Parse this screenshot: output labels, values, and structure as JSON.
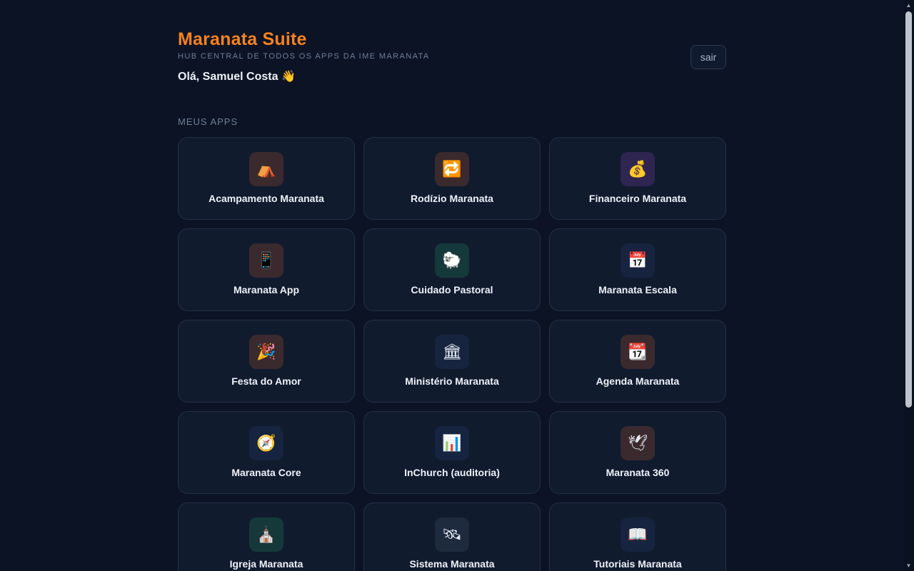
{
  "header": {
    "title": "Maranata Suite",
    "subtitle": "HUB CENTRAL DE TODOS OS APPS DA IME MARANATA",
    "greeting": "Olá, Samuel Costa 👋",
    "logout_label": "sair"
  },
  "section": {
    "label": "MEUS APPS"
  },
  "apps": [
    {
      "label": "Acampamento Maranata",
      "icon": "⛺",
      "icon_name": "camping-icon",
      "icon_bg": "#3a2a2e"
    },
    {
      "label": "Rodízio Maranata",
      "icon": "🔁",
      "icon_name": "repeat-icon",
      "icon_bg": "#3a2a2e"
    },
    {
      "label": "Financeiro Maranata",
      "icon": "💰",
      "icon_name": "money-bag-icon",
      "icon_bg": "#2e2550"
    },
    {
      "label": "Maranata App",
      "icon": "📱",
      "icon_name": "mobile-phone-icon",
      "icon_bg": "#3a2a2e"
    },
    {
      "label": "Cuidado Pastoral",
      "icon": "🐑",
      "icon_name": "sheep-icon",
      "icon_bg": "#15393b"
    },
    {
      "label": "Maranata Escala",
      "icon": "📅",
      "icon_name": "calendar-icon",
      "icon_bg": "#172440"
    },
    {
      "label": "Festa do Amor",
      "icon": "🎉",
      "icon_name": "party-popper-icon",
      "icon_bg": "#3a2a2e"
    },
    {
      "label": "Ministério Maranata",
      "icon": "🏛",
      "icon_name": "classical-building-icon",
      "icon_bg": "#172440"
    },
    {
      "label": "Agenda Maranata",
      "icon": "📆",
      "icon_name": "tear-off-calendar-icon",
      "icon_bg": "#3a2a2e"
    },
    {
      "label": "Maranata Core",
      "icon": "🧭",
      "icon_name": "compass-icon",
      "icon_bg": "#172440"
    },
    {
      "label": "InChurch (auditoria)",
      "icon": "📊",
      "icon_name": "bar-chart-icon",
      "icon_bg": "#172440"
    },
    {
      "label": "Maranata 360",
      "icon": "🕊",
      "icon_name": "dove-icon",
      "icon_bg": "#3a2a2e"
    },
    {
      "label": "Igreja Maranata",
      "icon": "⛪",
      "icon_name": "church-icon",
      "icon_bg": "#15393b"
    },
    {
      "label": "Sistema Maranata",
      "icon": "🛰",
      "icon_name": "satellite-icon",
      "icon_bg": "#1e2a3e"
    },
    {
      "label": "Tutoriais Maranata",
      "icon": "📖",
      "icon_name": "open-book-icon",
      "icon_bg": "#172440"
    }
  ],
  "colors": {
    "background": "#0b1324",
    "card_background": "#111b2e",
    "card_border": "#233047",
    "accent": "#f58220",
    "muted_text": "#6f7f98"
  }
}
